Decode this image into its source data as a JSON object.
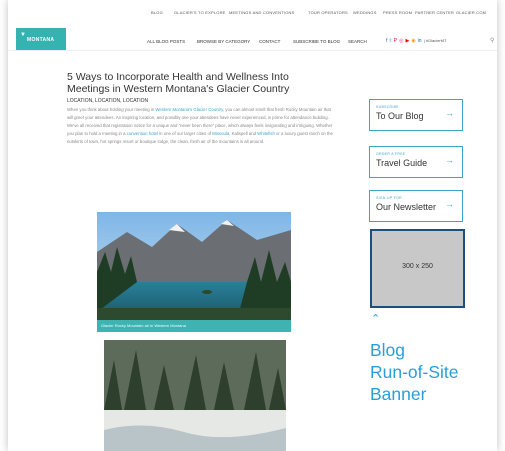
{
  "top_nav": [
    "BLOG",
    "GLACIER'S TO EXPLORE",
    "MEETINGS AND CONVENTIONS",
    "TOUR OPERATORS",
    "WEDDINGS",
    "PRESS ROOM",
    "PARTNER CENTER",
    "GLACIER.COM"
  ],
  "logo": {
    "mark": "▼",
    "text": "MONTANA"
  },
  "main_nav": [
    "ALL BLOG POSTS",
    "BROWSE BY CATEGORY",
    "CONTACT",
    "SUBSCRIBE TO BLOG",
    "SEARCH"
  ],
  "social": {
    "icons": [
      "facebook-icon",
      "twitter-icon",
      "pinterest-icon",
      "instagram-icon",
      "youtube-icon",
      "rss-icon",
      "linkedin-icon"
    ],
    "glyphs": [
      "f",
      "𝕥",
      "P",
      "◎",
      "▶",
      "◉",
      "in"
    ],
    "colors": [
      "#3b5998",
      "#1da1f2",
      "#e60023",
      "#c13584",
      "#ff0000",
      "#f7931e",
      "#0077b5"
    ],
    "hashtag": "| #GlacierMT"
  },
  "article": {
    "title": "5 Ways to Incorporate Health and Wellness Into Meetings in Western Montana's Glacier Country",
    "subhead": "LOCATION, LOCATION, LOCATION",
    "p1": "When you think about holding your meeting in ",
    "link1": "Western Montana's Glacier Country",
    "p2": ", you can almost smell that fresh Rocky Mountain air that will greet your attendees. An inspiring location, and possibly one your attendees have never experienced, is prime for attendance building. We've all received that registration notice for a unique and \"never been there\" place, which always feels invigorating and intriguing. Whether you plan to hold a meeting in a ",
    "link2": "convention hotel",
    "p3": " in one of our larger cities of ",
    "link3": "Missoula",
    "p4": ", Kalispell and ",
    "link4": "Whitefish",
    "p5": " or a luxury guest ranch on the outskirts of town, hot springs resort or boutique lodge, the clean, fresh air of the mountains is all around.",
    "photo_caption": "Glacier Rocky Mountain air in Western Montana"
  },
  "sidebar": [
    {
      "small": "SUBSCRIBE",
      "big": "To Our Blog",
      "arrow": "→"
    },
    {
      "small": "ORDER A FREE",
      "big": "Travel Guide",
      "arrow": "→"
    },
    {
      "small": "SIGN UP FOR",
      "big": "Our Newsletter",
      "arrow": "→"
    }
  ],
  "ad": {
    "size_label": "300 x 250"
  },
  "annotation": {
    "caret": "^",
    "lines": [
      "Blog",
      "Run-of-Site",
      "Banner"
    ]
  },
  "colors": {
    "teal": "#34b3b0",
    "link": "#3aa6c9",
    "annotation": "#2a9fd6",
    "ad_border": "#1e4f7a"
  }
}
